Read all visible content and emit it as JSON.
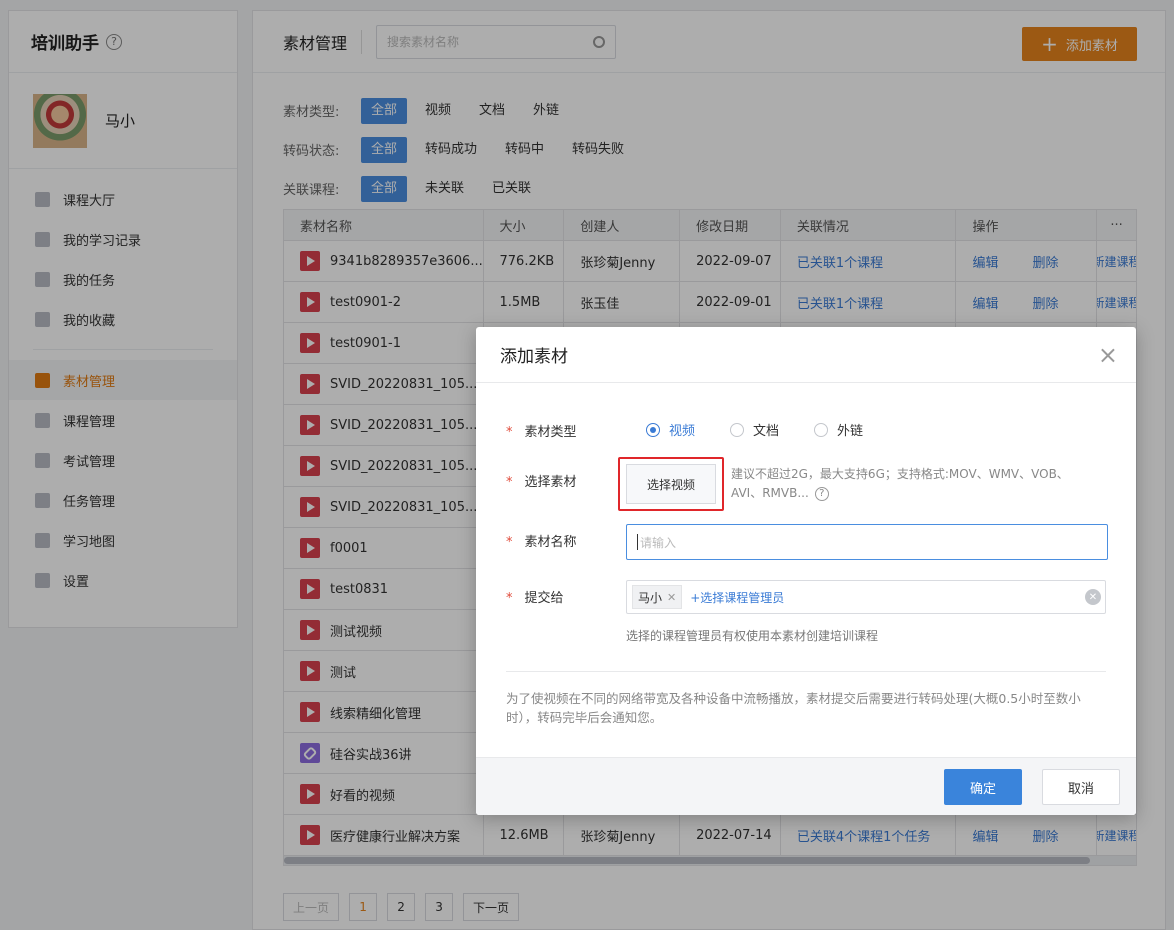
{
  "sidebar": {
    "title": "培训助手",
    "help": "?",
    "username": "马小",
    "nav_group1": [
      {
        "label": "课程大厅",
        "icon": "bank-icon"
      },
      {
        "label": "我的学习记录",
        "icon": "clock-icon"
      },
      {
        "label": "我的任务",
        "icon": "check-square-icon"
      },
      {
        "label": "我的收藏",
        "icon": "star-icon"
      }
    ],
    "nav_group2": [
      {
        "label": "素材管理",
        "icon": "media-icon",
        "active": true
      },
      {
        "label": "课程管理",
        "icon": "course-icon"
      },
      {
        "label": "考试管理",
        "icon": "exam-icon"
      },
      {
        "label": "任务管理",
        "icon": "task-icon"
      },
      {
        "label": "学习地图",
        "icon": "map-pin-icon"
      },
      {
        "label": "设置",
        "icon": "gear-icon"
      }
    ]
  },
  "header": {
    "title": "素材管理",
    "search_placeholder": "搜索素材名称",
    "add_label": "添加素材"
  },
  "filters": [
    {
      "label": "素材类型:",
      "options": [
        "全部",
        "视频",
        "文档",
        "外链"
      ]
    },
    {
      "label": "转码状态:",
      "options": [
        "全部",
        "转码成功",
        "转码中",
        "转码失败"
      ]
    },
    {
      "label": "关联课程:",
      "options": [
        "全部",
        "未关联",
        "已关联"
      ]
    }
  ],
  "table": {
    "columns": [
      "素材名称",
      "大小",
      "创建人",
      "修改日期",
      "关联情况",
      "操作",
      "···"
    ],
    "ops": [
      "编辑",
      "删除",
      "新建课程"
    ],
    "rows": [
      {
        "name": "9341b8289357e3606...",
        "size": "776.2KB",
        "creator": "张珍菊Jenny",
        "date": "2022-09-07",
        "relation": "已关联1个课程",
        "type": "video"
      },
      {
        "name": "test0901-2",
        "size": "1.5MB",
        "creator": "张玉佳",
        "date": "2022-09-01",
        "relation": "已关联1个课程",
        "type": "video"
      },
      {
        "name": "test0901-1",
        "size": "",
        "creator": "",
        "date": "",
        "relation": "",
        "type": "video"
      },
      {
        "name": "SVID_20220831_105...",
        "size": "",
        "creator": "",
        "date": "",
        "relation": "",
        "type": "video"
      },
      {
        "name": "SVID_20220831_105...",
        "size": "",
        "creator": "",
        "date": "",
        "relation": "",
        "type": "video"
      },
      {
        "name": "SVID_20220831_105...",
        "size": "",
        "creator": "",
        "date": "",
        "relation": "",
        "type": "video"
      },
      {
        "name": "SVID_20220831_105...",
        "size": "",
        "creator": "",
        "date": "",
        "relation": "",
        "type": "video"
      },
      {
        "name": "f0001",
        "size": "",
        "creator": "",
        "date": "",
        "relation": "",
        "type": "video"
      },
      {
        "name": "test0831",
        "size": "",
        "creator": "",
        "date": "",
        "relation": "",
        "type": "video"
      },
      {
        "name": "测试视频",
        "size": "",
        "creator": "",
        "date": "",
        "relation": "",
        "type": "video"
      },
      {
        "name": "测试",
        "size": "",
        "creator": "",
        "date": "",
        "relation": "",
        "type": "video"
      },
      {
        "name": "线索精细化管理",
        "size": "",
        "creator": "",
        "date": "",
        "relation": "",
        "type": "video"
      },
      {
        "name": "硅谷实战36讲",
        "size": "",
        "creator": "",
        "date": "",
        "relation": "",
        "type": "link"
      },
      {
        "name": "好看的视频",
        "size": "",
        "creator": "",
        "date": "",
        "relation": "",
        "type": "video"
      },
      {
        "name": "医疗健康行业解决方案",
        "size": "12.6MB",
        "creator": "张珍菊Jenny",
        "date": "2022-07-14",
        "relation": "已关联4个课程1个任务",
        "type": "video"
      }
    ]
  },
  "pager": {
    "prev": "上一页",
    "pages": [
      "1",
      "2",
      "3"
    ],
    "next": "下一页"
  },
  "modal": {
    "title": "添加素材",
    "close": "×",
    "type_label": "素材类型",
    "type_options": [
      "视频",
      "文档",
      "外链"
    ],
    "pick_label": "选择素材",
    "pick_button": "选择视频",
    "pick_hint": "建议不超过2G，最大支持6G；支持格式:MOV、WMV、VOB、AVI、RMVB...",
    "pick_help": "?",
    "name_label": "素材名称",
    "name_placeholder": "请输入",
    "submit_label": "提交给",
    "submit_tag": "马小",
    "submit_add": "+选择课程管理员",
    "submit_hint": "选择的课程管理员有权使用本素材创建培训课程",
    "notice": "为了使视频在不同的网络带宽及各种设备中流畅播放，素材提交后需要进行转码处理(大概0.5小时至数小时），转码完毕后会通知您。",
    "ok": "确定",
    "cancel": "取消",
    "required_mark": "*"
  }
}
